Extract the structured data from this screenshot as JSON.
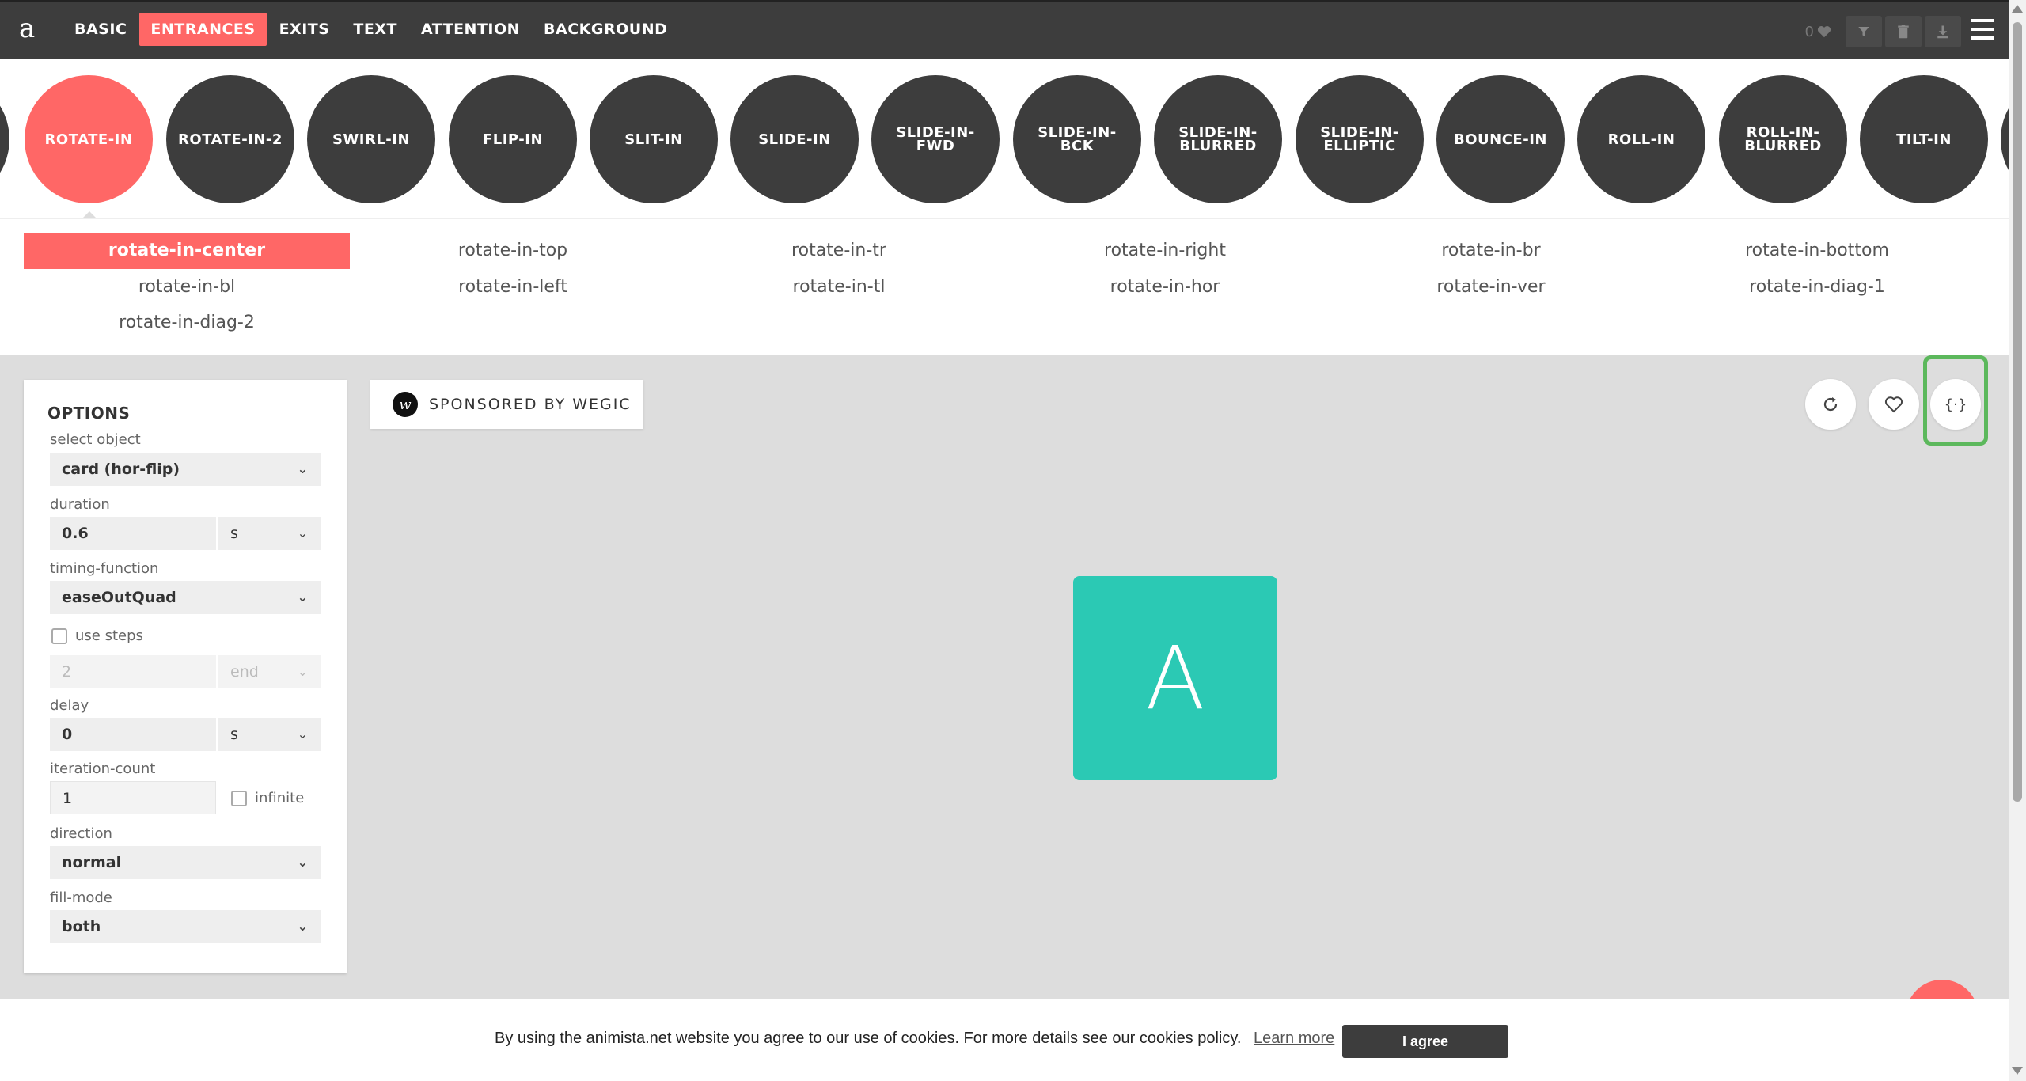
{
  "app": {
    "logo": "a"
  },
  "nav": {
    "items": [
      {
        "label": "BASIC",
        "active": false
      },
      {
        "label": "ENTRANCES",
        "active": true
      },
      {
        "label": "EXITS",
        "active": false
      },
      {
        "label": "TEXT",
        "active": false
      },
      {
        "label": "ATTENTION",
        "active": false
      },
      {
        "label": "BACKGROUND",
        "active": false
      }
    ],
    "fav_count": "0"
  },
  "categories": [
    {
      "label": "ROTATE-IN",
      "active": true
    },
    {
      "label": "ROTATE-IN-2",
      "active": false
    },
    {
      "label": "SWIRL-IN",
      "active": false
    },
    {
      "label": "FLIP-IN",
      "active": false
    },
    {
      "label": "SLIT-IN",
      "active": false
    },
    {
      "label": "SLIDE-IN",
      "active": false
    },
    {
      "label": "SLIDE-IN-FWD",
      "active": false
    },
    {
      "label": "SLIDE-IN-BCK",
      "active": false
    },
    {
      "label": "SLIDE-IN-BLURRED",
      "active": false
    },
    {
      "label": "SLIDE-IN-ELLIPTIC",
      "active": false
    },
    {
      "label": "BOUNCE-IN",
      "active": false
    },
    {
      "label": "ROLL-IN",
      "active": false
    },
    {
      "label": "ROLL-IN-BLURRED",
      "active": false
    },
    {
      "label": "TILT-IN",
      "active": false
    }
  ],
  "variations": [
    {
      "label": "rotate-in-center",
      "active": true
    },
    {
      "label": "rotate-in-top",
      "active": false
    },
    {
      "label": "rotate-in-tr",
      "active": false
    },
    {
      "label": "rotate-in-right",
      "active": false
    },
    {
      "label": "rotate-in-br",
      "active": false
    },
    {
      "label": "rotate-in-bottom",
      "active": false
    },
    {
      "label": "rotate-in-bl",
      "active": false
    },
    {
      "label": "rotate-in-left",
      "active": false
    },
    {
      "label": "rotate-in-tl",
      "active": false
    },
    {
      "label": "rotate-in-hor",
      "active": false
    },
    {
      "label": "rotate-in-ver",
      "active": false
    },
    {
      "label": "rotate-in-diag-1",
      "active": false
    },
    {
      "label": "rotate-in-diag-2",
      "active": false
    }
  ],
  "options": {
    "title": "OPTIONS",
    "select_object": {
      "label": "select object",
      "value": "card (hor-flip)"
    },
    "duration": {
      "label": "duration",
      "value": "0.6",
      "unit": "s"
    },
    "timing_function": {
      "label": "timing-function",
      "value": "easeOutQuad"
    },
    "use_steps": {
      "label": "use steps",
      "checked": false,
      "steps": "2",
      "position": "end"
    },
    "delay": {
      "label": "delay",
      "value": "0",
      "unit": "s"
    },
    "iteration_count": {
      "label": "iteration-count",
      "value": "1",
      "infinite_label": "infinite"
    },
    "direction": {
      "label": "direction",
      "value": "normal"
    },
    "fill_mode": {
      "label": "fill-mode",
      "value": "both"
    }
  },
  "sponsor": {
    "logo_letter": "w",
    "text": "SPONSORED BY WEGIC"
  },
  "actions": {
    "code_label": "{·}"
  },
  "preview": {
    "letter": "A",
    "color": "#2bc9b4"
  },
  "cookie": {
    "text": "By using the animista.net website you agree to our use of cookies. For more details see our cookies policy.",
    "link": "Learn more",
    "button": "I agree"
  },
  "colors": {
    "accent": "#ff6766",
    "dark": "#3d3d3d",
    "highlight": "#5cb85c"
  }
}
